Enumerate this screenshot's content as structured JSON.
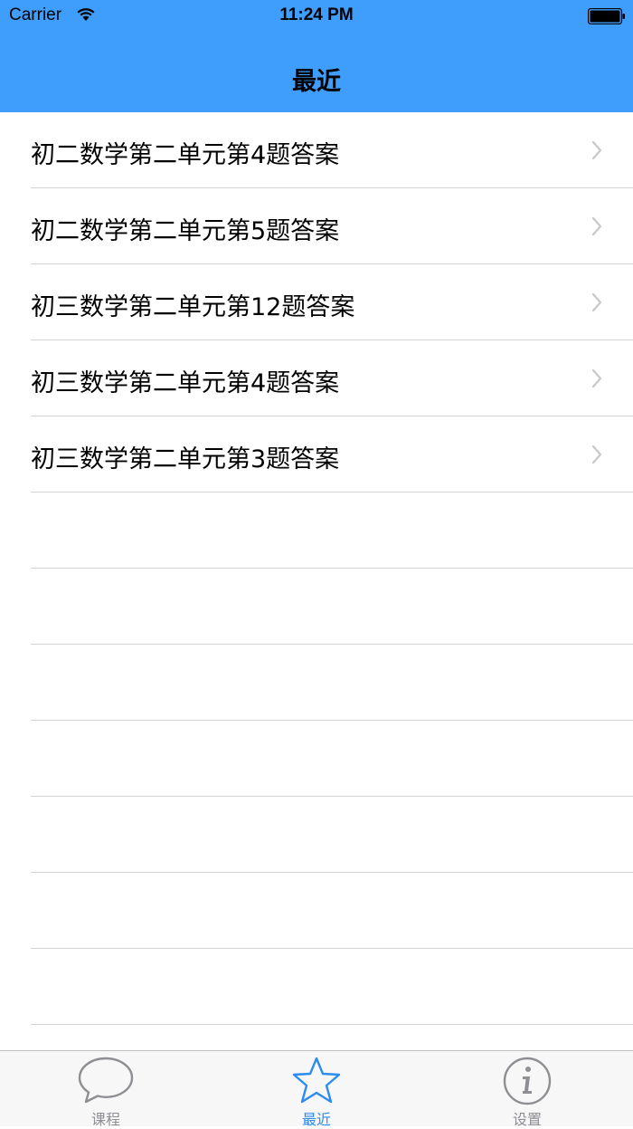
{
  "status_bar": {
    "carrier": "Carrier",
    "time": "11:24 PM"
  },
  "nav": {
    "title": "最近",
    "background_color": "#3f9dfb"
  },
  "list": {
    "items": [
      {
        "label": "初二数学第二单元第4题答案"
      },
      {
        "label": "初二数学第二单元第5题答案"
      },
      {
        "label": "初三数学第二单元第12题答案"
      },
      {
        "label": "初三数学第二单元第4题答案"
      },
      {
        "label": "初三数学第二单元第3题答案"
      }
    ]
  },
  "tabbar": {
    "tabs": [
      {
        "label": "课程",
        "icon": "speech-bubble-icon",
        "active": false
      },
      {
        "label": "最近",
        "icon": "star-icon",
        "active": true
      },
      {
        "label": "设置",
        "icon": "info-icon",
        "active": false
      }
    ],
    "active_color": "#2d8cf0",
    "inactive_color": "#8e8e93"
  }
}
